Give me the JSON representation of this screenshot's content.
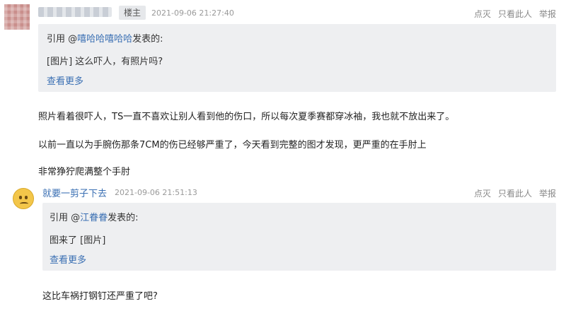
{
  "post1": {
    "badge": "楼主",
    "time": "2021-09-06 21:27:40",
    "actions": [
      "点灭",
      "只看此人",
      "举报"
    ],
    "quote": {
      "prefix": "引用 @",
      "mention": "嘻哈哈嘻哈哈",
      "suffix": "发表的:",
      "content": "[图片] 这么吓人，有照片吗?",
      "more": "查看更多"
    },
    "body": [
      "照片看着很吓人，TS一直不喜欢让别人看到他的伤口，所以每次夏季赛都穿冰袖，我也就不放出来了。",
      "以前一直以为手腕伤那条7CM的伤已经够严重了，今天看到完整的图才发现，更严重的在手肘上",
      "非常狰狞爬满整个手肘"
    ]
  },
  "post2": {
    "username": "就要一剪子下去",
    "time": "2021-09-06 21:51:13",
    "actions": [
      "点灭",
      "只看此人",
      "举报"
    ],
    "quote": {
      "prefix": "引用 @",
      "mention": "江眷眷",
      "suffix": "发表的:",
      "content": "图来了 [图片]",
      "more": "查看更多"
    },
    "body": [
      "这比车祸打钢钉还严重了吧?"
    ]
  }
}
